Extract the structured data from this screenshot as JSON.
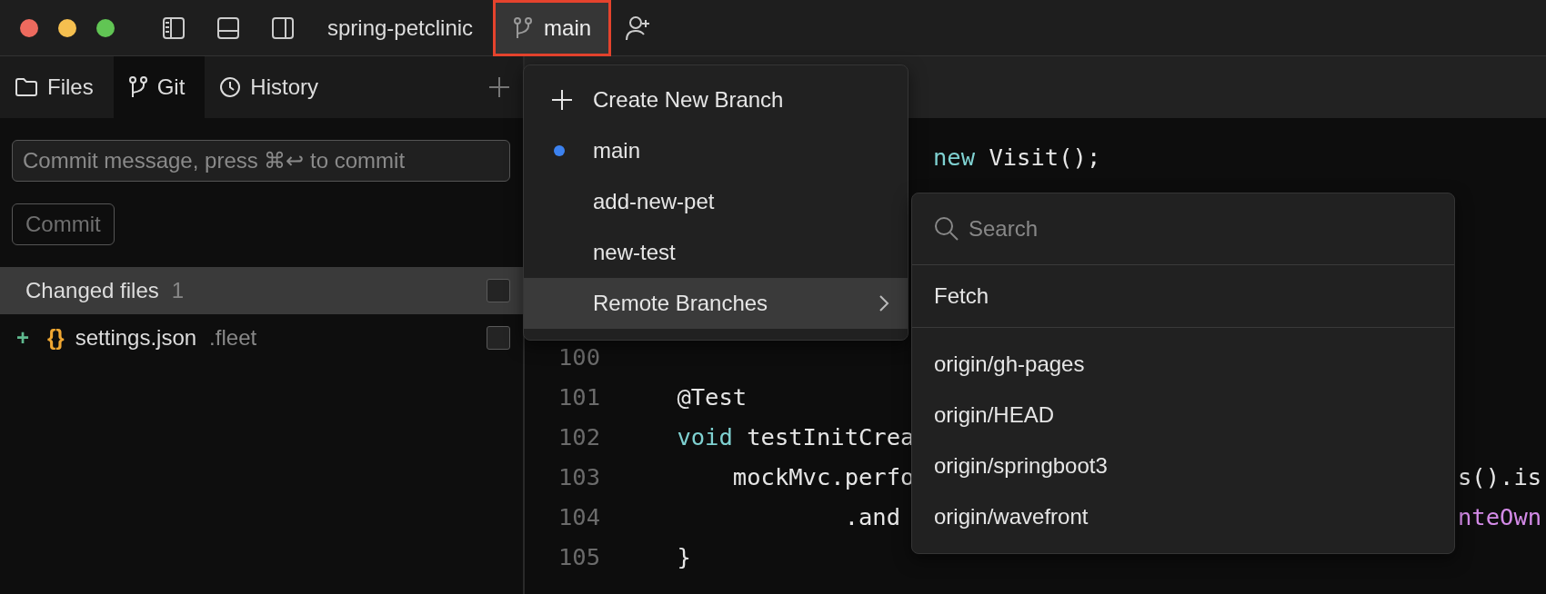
{
  "window_controls": [
    {
      "color": "#ed6a5e"
    },
    {
      "color": "#f5bf4f"
    },
    {
      "color": "#61c554"
    }
  ],
  "toolbar": {
    "layout_buttons": [
      {
        "kind": "left-panel"
      },
      {
        "kind": "bottom-panel"
      },
      {
        "kind": "right-panel"
      }
    ],
    "project": "spring-petclinic",
    "branch_button": {
      "label": "main",
      "highlighted": true
    }
  },
  "side_panel": {
    "tabs": [
      {
        "label": "Files",
        "selected": false
      },
      {
        "label": "Git",
        "selected": true
      },
      {
        "label": "History",
        "selected": false
      }
    ],
    "commit_field": {
      "placeholder": "Commit message, press ⌘↩ to commit"
    },
    "commit_button": {
      "label": "Commit",
      "disabled": true
    },
    "changes": {
      "title": "Changed files",
      "count": "1",
      "highlighted": true,
      "checked": false,
      "files": [
        {
          "status": "+",
          "file_icon": "{}",
          "name": "settings.json",
          "folder": ".fleet",
          "checked": false
        }
      ]
    }
  },
  "editor": {
    "fragment": [
      {
        "text": "new",
        "kind": "keyword"
      },
      {
        "text": " Visit();",
        "kind": "plain"
      }
    ],
    "lines": [
      {
        "number": "100"
      },
      {
        "number": "101",
        "code": [
          {
            "text": "    @Test",
            "kind": "plain"
          }
        ]
      },
      {
        "number": "102",
        "code": [
          {
            "text": "    void",
            "kind": "keyword"
          },
          {
            "text": " testInitCrea",
            "kind": "plain"
          }
        ]
      },
      {
        "number": "103",
        "code": [
          {
            "text": "        mockMvc.perfo",
            "kind": "plain"
          }
        ],
        "tail": [
          {
            "text": "s().is",
            "kind": "plain"
          }
        ]
      },
      {
        "number": "104",
        "code": [
          {
            "text": "                .and",
            "kind": "plain"
          }
        ],
        "tail": [
          {
            "text": "nteOwn",
            "kind": "call"
          }
        ]
      },
      {
        "number": "105",
        "code": [
          {
            "text": "    }",
            "kind": "plain"
          }
        ]
      }
    ]
  },
  "branch_menu": {
    "items": [
      {
        "kind": "action",
        "label": "Create New Branch",
        "selected": false
      },
      {
        "kind": "branch",
        "label": "main",
        "current": true,
        "selected": false
      },
      {
        "kind": "branch",
        "label": "add-new-pet",
        "current": false,
        "selected": false
      },
      {
        "kind": "branch",
        "label": "new-test",
        "current": false,
        "selected": false
      },
      {
        "kind": "submenu",
        "label": "Remote Branches",
        "selected": true
      }
    ]
  },
  "remote_menu": {
    "search": {
      "placeholder": "Search"
    },
    "actions": [
      "Fetch"
    ],
    "branches": [
      "origin/gh-pages",
      "origin/HEAD",
      "origin/springboot3",
      "origin/wavefront"
    ]
  }
}
